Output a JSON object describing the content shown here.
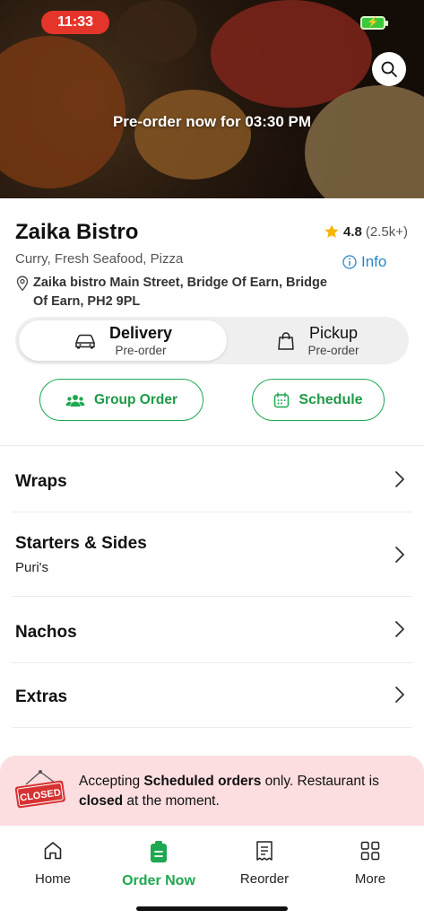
{
  "status_bar": {
    "time": "11:33"
  },
  "hero": {
    "preorder_text": "Pre-order now for 03:30 PM"
  },
  "restaurant": {
    "name": "Zaika Bistro",
    "rating": "4.8",
    "rating_count": "(2.5k+)",
    "cuisines": "Curry, Fresh Seafood, Pizza",
    "info_label": "Info",
    "address_name": "Zaika bistro",
    "address_line": "Main Street, Bridge Of Earn, Bridge Of Earn, PH2 9PL"
  },
  "modes": {
    "delivery": {
      "label": "Delivery",
      "sub": "Pre-order",
      "active": true
    },
    "pickup": {
      "label": "Pickup",
      "sub": "Pre-order",
      "active": false
    }
  },
  "actions": {
    "group_order": "Group Order",
    "schedule": "Schedule"
  },
  "categories": [
    {
      "title": "Wraps",
      "subtitle": ""
    },
    {
      "title": "Starters & Sides",
      "subtitle": "Puri's"
    },
    {
      "title": "Nachos",
      "subtitle": ""
    },
    {
      "title": "Extras",
      "subtitle": ""
    }
  ],
  "notice": {
    "sign_text": "CLOSED",
    "msg_pre": "Accepting ",
    "msg_bold1": "Scheduled orders",
    "msg_mid": " only. Restaurant is ",
    "msg_bold2": "closed",
    "msg_post": " at the moment."
  },
  "nav": {
    "home": "Home",
    "order_now": "Order Now",
    "reorder": "Reorder",
    "more": "More"
  },
  "colors": {
    "accent": "#1ea851",
    "notice_bg": "#fcdde0",
    "info_blue": "#2a86c9",
    "star": "#f6b400",
    "status_red": "#e5352b"
  }
}
